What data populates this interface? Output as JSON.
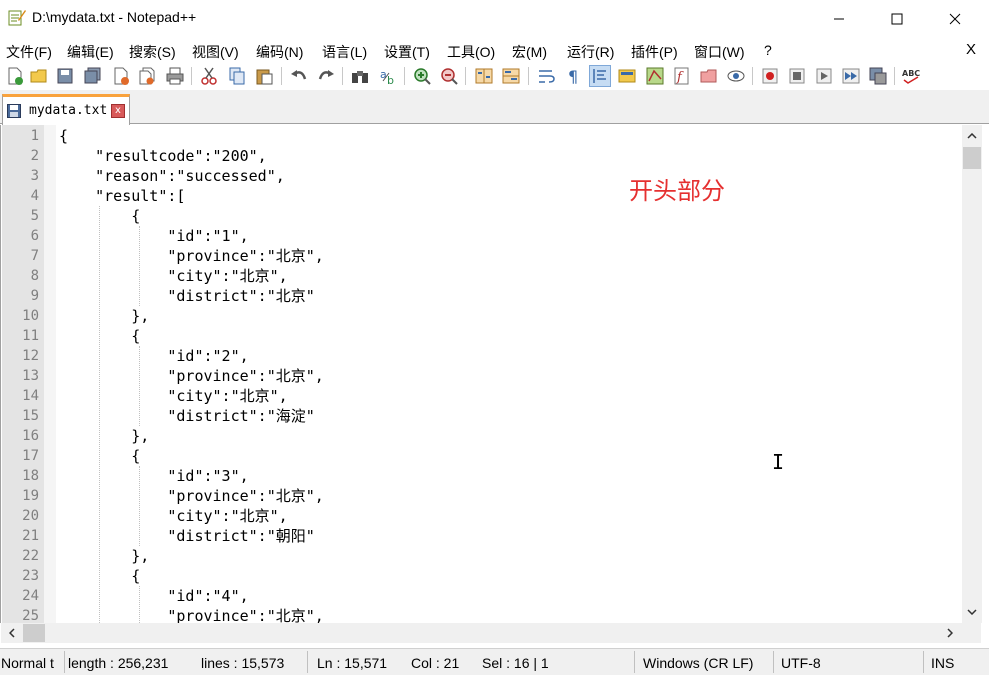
{
  "window": {
    "title": "D:\\mydata.txt - Notepad++"
  },
  "menu": {
    "items": [
      "文件(F)",
      "编辑(E)",
      "搜索(S)",
      "视图(V)",
      "编码(N)",
      "语言(L)",
      "设置(T)",
      "工具(O)",
      "宏(M)",
      "运行(R)",
      "插件(P)",
      "窗口(W)",
      "?"
    ],
    "close_label": "X"
  },
  "tab": {
    "label": "mydata.txt",
    "close_label": "x"
  },
  "editor": {
    "line_numbers": [
      "1",
      "2",
      "3",
      "4",
      "5",
      "6",
      "7",
      "8",
      "9",
      "10",
      "11",
      "12",
      "13",
      "14",
      "15",
      "16",
      "17",
      "18",
      "19",
      "20",
      "21",
      "22",
      "23",
      "24",
      "25"
    ],
    "lines": [
      "{",
      "    \"resultcode\":\"200\",",
      "    \"reason\":\"successed\",",
      "    \"result\":[",
      "        {",
      "            \"id\":\"1\",",
      "            \"province\":\"北京\",",
      "            \"city\":\"北京\",",
      "            \"district\":\"北京\"",
      "        },",
      "        {",
      "            \"id\":\"2\",",
      "            \"province\":\"北京\",",
      "            \"city\":\"北京\",",
      "            \"district\":\"海淀\"",
      "        },",
      "        {",
      "            \"id\":\"3\",",
      "            \"province\":\"北京\",",
      "            \"city\":\"北京\",",
      "            \"district\":\"朝阳\"",
      "        },",
      "        {",
      "            \"id\":\"4\",",
      "            \"province\":\"北京\","
    ],
    "annotation": "开头部分"
  },
  "status": {
    "doc_type": "Normal t",
    "length": "length : 256,231",
    "lines": "lines : 15,573",
    "ln": "Ln : 15,571",
    "col": "Col : 21",
    "sel": "Sel : 16 | 1",
    "eol": "Windows (CR LF)",
    "encoding": "UTF-8",
    "mode": "INS"
  },
  "colors": {
    "tab_accent": "#f9a23c",
    "annotation": "#e53030",
    "gutter_bg": "#e4e4e4"
  }
}
